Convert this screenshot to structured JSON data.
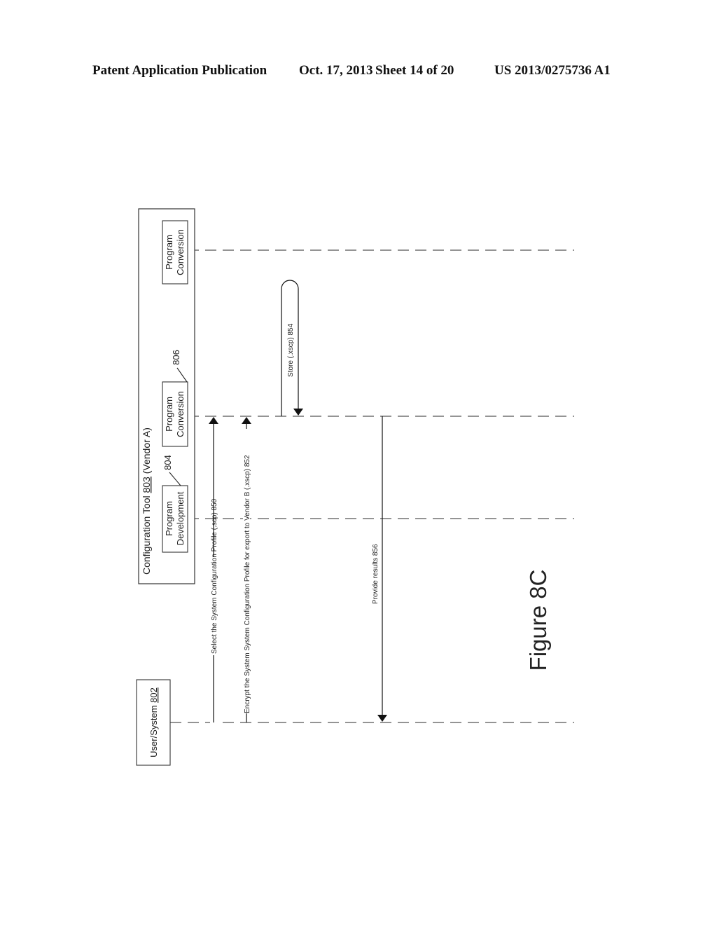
{
  "header": {
    "publication": "Patent Application Publication",
    "date": "Oct. 17, 2013",
    "sheet": "Sheet 14 of 20",
    "number": "US 2013/0275736 A1"
  },
  "diagram": {
    "type": "sequence",
    "orientation": "rotated-90-ccw",
    "participants": {
      "config_tool": {
        "label_prefix": "Configuration Tool ",
        "ref": "803",
        "label_suffix": " (Vendor A)"
      },
      "program_conversion_top": {
        "line1": "Program",
        "line2": "Conversion"
      },
      "program_conversion": {
        "line1": "Program",
        "line2": "Conversion",
        "ref": "806"
      },
      "program_development": {
        "line1": "Program",
        "line2": "Development",
        "ref": "804"
      },
      "user_system": {
        "label_prefix": "User/System ",
        "ref": "802"
      }
    },
    "messages": [
      {
        "id": "850",
        "label": "Select the System Configuration Profile (.scp) 850",
        "from": "User/System 802",
        "to": "Program Conversion 806"
      },
      {
        "id": "852",
        "label": "Encrypt the System System Configuration Profile for export to Vendor B (.xscp) 852",
        "from": "User/System 802",
        "to": "Program Conversion 806"
      },
      {
        "id": "854",
        "label": "Store (.xscp) 854",
        "from": "Program Conversion 806",
        "to": "Program Conversion 806"
      },
      {
        "id": "856",
        "label": "Provide results 856",
        "from": "Program Conversion 806",
        "to": "User/System 802"
      }
    ],
    "figure_label": "Figure 8C"
  }
}
